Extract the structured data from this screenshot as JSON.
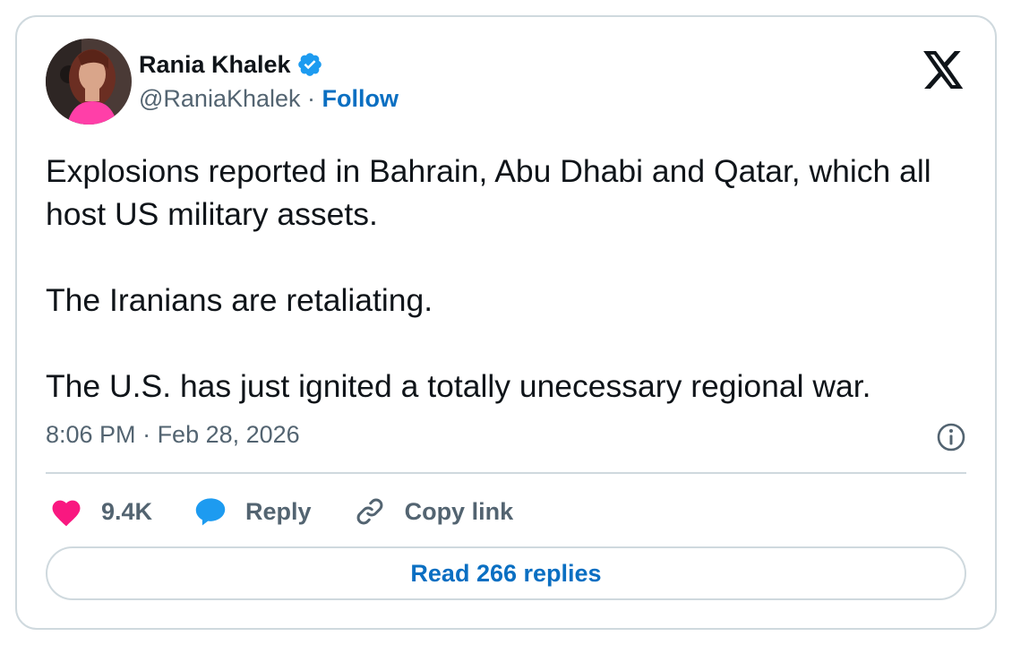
{
  "author": {
    "name": "Rania Khalek",
    "handle": "@RaniaKhalek",
    "separator": " · ",
    "follow_label": "Follow",
    "verified": true,
    "avatar_icon": "profile-photo"
  },
  "tweet": {
    "paragraphs": [
      "Explosions reported in Bahrain, Abu Dhabi and Qatar, which all host US military assets.",
      "The Iranians are retaliating.",
      "The U.S. has just ignited a totally unecessary regional war."
    ],
    "time": "8:06 PM",
    "date": "Feb 28, 2026",
    "meta_separator": " · "
  },
  "actions": {
    "like_count": "9.4K",
    "reply_label": "Reply",
    "copy_label": "Copy link"
  },
  "footer": {
    "read_replies_label": "Read 266 replies"
  },
  "colors": {
    "accent": "#1d9bf0",
    "link": "#0a6fc2",
    "like": "#f91880",
    "muted": "#536471",
    "border": "#cfd9de"
  }
}
